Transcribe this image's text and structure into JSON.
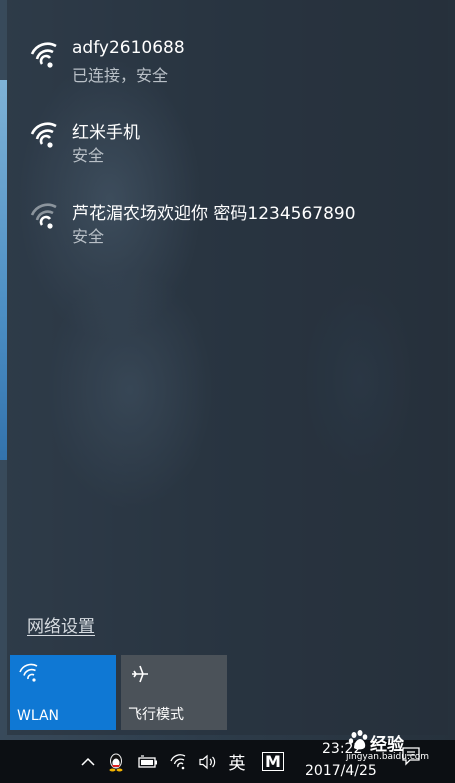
{
  "networks": [
    {
      "name": "adfy2610688",
      "status": "已连接，安全",
      "icon": "wifi-full-icon"
    },
    {
      "name": "红米手机",
      "status": "安全",
      "icon": "wifi-full-icon"
    },
    {
      "name": "芦花湄农场欢迎你 密码1234567890",
      "status": "安全",
      "icon": "wifi-weak-icon"
    }
  ],
  "network_settings_label": "网络设置",
  "quick_actions": [
    {
      "label": "WLAN",
      "icon": "wifi-icon",
      "active": true,
      "color": "#0f78d4"
    },
    {
      "label": "飞行模式",
      "icon": "airplane-icon",
      "active": false,
      "color": "#4b5259"
    }
  ],
  "taskbar": {
    "ime_label": "英",
    "ime_mode_label": "M",
    "time": "23:22",
    "date": "2017/4/25"
  },
  "watermark": {
    "text": "经验",
    "url": "jingyan.baidu.com"
  }
}
